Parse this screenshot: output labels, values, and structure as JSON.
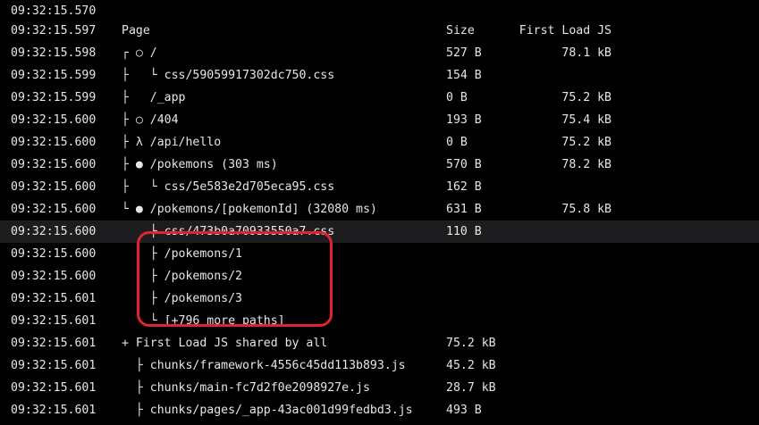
{
  "header": {
    "timestamp": "09:32:15.597",
    "page_label": "Page",
    "size_label": "Size",
    "first_load_label": "First Load JS"
  },
  "rows": [
    {
      "ts": "09:32:15.570",
      "route": "",
      "size": "",
      "first_load": ""
    },
    {
      "ts": "09:32:15.598",
      "route": "┌ ○ /",
      "size": "527 B",
      "first_load": "78.1 kB"
    },
    {
      "ts": "09:32:15.599",
      "route": "├   └ css/59059917302dc750.css",
      "size": "154 B",
      "first_load": ""
    },
    {
      "ts": "09:32:15.599",
      "route": "├   /_app",
      "size": "0 B",
      "first_load": "75.2 kB"
    },
    {
      "ts": "09:32:15.600",
      "route": "├ ○ /404",
      "size": "193 B",
      "first_load": "75.4 kB"
    },
    {
      "ts": "09:32:15.600",
      "route": "├ λ /api/hello",
      "size": "0 B",
      "first_load": "75.2 kB"
    },
    {
      "ts": "09:32:15.600",
      "route": "├ ● /pokemons (303 ms)",
      "size": "570 B",
      "first_load": "78.2 kB"
    },
    {
      "ts": "09:32:15.600",
      "route": "├   └ css/5e583e2d705eca95.css",
      "size": "162 B",
      "first_load": ""
    },
    {
      "ts": "09:32:15.600",
      "route": "└ ● /pokemons/[pokemonId] (32080 ms)",
      "size": "631 B",
      "first_load": "75.8 kB"
    },
    {
      "ts": "09:32:15.600",
      "route": "    ├ css/473b0a70933550a7.css",
      "size": "110 B",
      "first_load": ""
    },
    {
      "ts": "09:32:15.600",
      "route": "    ├ /pokemons/1",
      "size": "",
      "first_load": ""
    },
    {
      "ts": "09:32:15.600",
      "route": "    ├ /pokemons/2",
      "size": "",
      "first_load": ""
    },
    {
      "ts": "09:32:15.601",
      "route": "    ├ /pokemons/3",
      "size": "",
      "first_load": ""
    },
    {
      "ts": "09:32:15.601",
      "route": "    └ [+796 more paths]",
      "size": "",
      "first_load": ""
    },
    {
      "ts": "09:32:15.601",
      "route": "+ First Load JS shared by all",
      "size": "75.2 kB",
      "first_load": ""
    },
    {
      "ts": "09:32:15.601",
      "route": "  ├ chunks/framework-4556c45dd113b893.js",
      "size": "45.2 kB",
      "first_load": ""
    },
    {
      "ts": "09:32:15.601",
      "route": "  ├ chunks/main-fc7d2f0e2098927e.js",
      "size": "28.7 kB",
      "first_load": ""
    },
    {
      "ts": "09:32:15.601",
      "route": "  ├ chunks/pages/_app-43ac001d99fedbd3.js",
      "size": "493 B",
      "first_load": ""
    }
  ],
  "colors": {
    "background": "#000000",
    "text": "#e6e6e6",
    "highlight_row": "#1d1d1f",
    "annotation_box": "#e0242f"
  }
}
